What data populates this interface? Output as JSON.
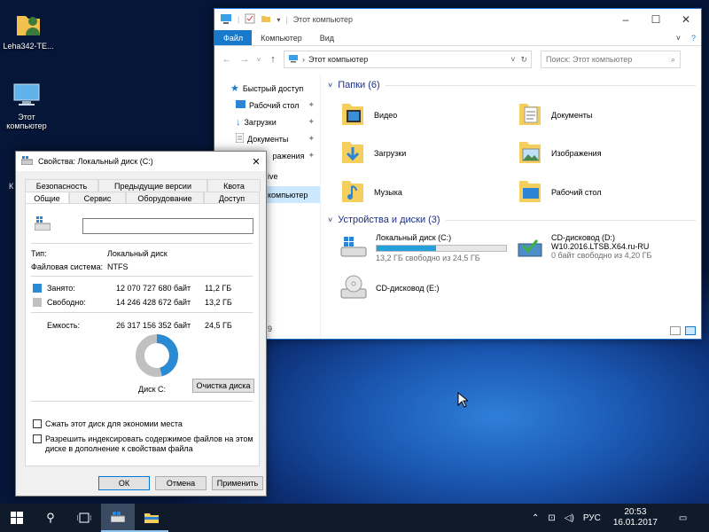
{
  "desktop": {
    "icons": [
      {
        "label": "Leha342-TE..."
      },
      {
        "label": "Этот компьютер"
      }
    ]
  },
  "explorer": {
    "title": "Этот компьютер",
    "ribbon_tabs": [
      "Файл",
      "Компьютер",
      "Вид"
    ],
    "address": "Этот компьютер",
    "search_placeholder": "Поиск: Этот компьютер",
    "nav": [
      {
        "label": "Быстрый доступ"
      },
      {
        "label": "Рабочий стол"
      },
      {
        "label": "Загрузки"
      },
      {
        "label": "Документы"
      },
      {
        "label": "ражения"
      },
      {
        "label": "ive"
      },
      {
        "label": "компьютер"
      }
    ],
    "status_count": "9",
    "folders_header": "Папки (6)",
    "folders": [
      {
        "label": "Видео",
        "icon": "video-folder-icon"
      },
      {
        "label": "Документы",
        "icon": "documents-folder-icon"
      },
      {
        "label": "Загрузки",
        "icon": "downloads-folder-icon"
      },
      {
        "label": "Изображения",
        "icon": "pictures-folder-icon"
      },
      {
        "label": "Музыка",
        "icon": "music-folder-icon"
      },
      {
        "label": "Рабочий стол",
        "icon": "desktop-folder-icon"
      }
    ],
    "devices_header": "Устройства и диски (3)",
    "devices": [
      {
        "label": "Локальный диск (C:)",
        "sub": "13,2 ГБ свободно из 24,5 ГБ",
        "used_fraction": 0.46
      },
      {
        "label": "CD-дисковод (D:)",
        "sub1": "W10.2016.LTSB.X64.ru-RU",
        "sub2": "0 байт свободно из 4,20 ГБ"
      },
      {
        "label": "CD-дисковод (E:)"
      }
    ]
  },
  "dialog": {
    "title": "Свойства: Локальный диск (C:)",
    "tabs_row1": [
      "Безопасность",
      "Предыдущие версии",
      "Квота"
    ],
    "tabs_row2": [
      "Общие",
      "Сервис",
      "Оборудование",
      "Доступ"
    ],
    "name_value": "",
    "type_label": "Тип:",
    "type_value": "Локальный диск",
    "fs_label": "Файловая система:",
    "fs_value": "NTFS",
    "used_label": "Занято:",
    "used_bytes": "12 070 727 680 байт",
    "used_gb": "11,2 ГБ",
    "free_label": "Свободно:",
    "free_bytes": "14 246 428 672 байт",
    "free_gb": "13,2 ГБ",
    "cap_label": "Емкость:",
    "cap_bytes": "26 317 156 352 байт",
    "cap_gb": "24,5 ГБ",
    "used_fraction": 0.46,
    "disk_label": "Диск C:",
    "cleanup_button": "Очистка диска",
    "compress_label": "Сжать этот диск для экономии места",
    "index_label": "Разрешить индексировать содержимое файлов на этом диске в дополнение к свойствам файла",
    "ok": "ОК",
    "cancel": "Отмена",
    "apply": "Применить",
    "colors": {
      "used": "#2a8ad4",
      "free": "#c0c0c0"
    }
  },
  "taskbar": {
    "lang": "РУС",
    "time": "20:53",
    "date": "16.01.2017"
  }
}
